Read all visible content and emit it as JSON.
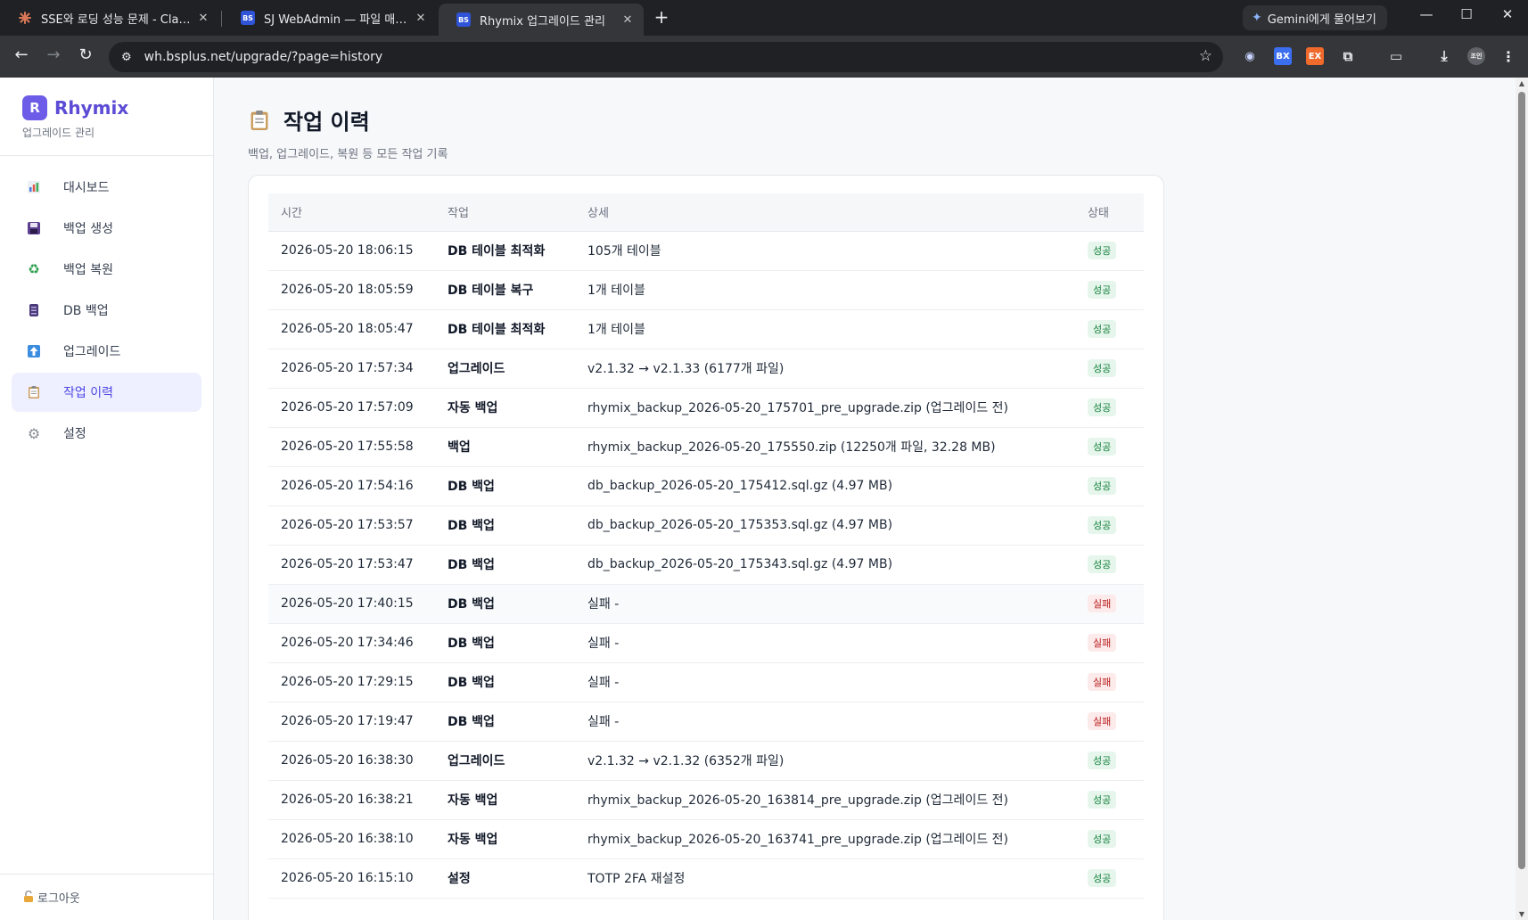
{
  "browser": {
    "tabs": [
      {
        "title": "SSE와 로딩 성능 문제 - Claude",
        "favicon": "claude-icon",
        "active": false
      },
      {
        "title": "SJ WebAdmin — 파일 매니저",
        "favicon": "bs-icon",
        "active": false
      },
      {
        "title": "Rhymix 업그레이드 관리",
        "favicon": "bs-icon",
        "active": true
      }
    ],
    "close_glyph": "✕",
    "new_tab_glyph": "+",
    "gemini_label": "Gemini에게 물어보기",
    "url": "wh.bsplus.net/upgrade/?page=history",
    "ext_labels": {
      "bx": "BX",
      "ex": "EX",
      "avatar": "조인"
    }
  },
  "sidebar": {
    "logo_letter": "R",
    "brand": "Rhymix",
    "brand_sub": "업그레이드 관리",
    "items": [
      {
        "label": "대시보드",
        "icon": "chart-icon",
        "active": false
      },
      {
        "label": "백업 생성",
        "icon": "floppy-icon",
        "active": false
      },
      {
        "label": "백업 복원",
        "icon": "recycle-icon",
        "active": false
      },
      {
        "label": "DB 백업",
        "icon": "database-icon",
        "active": false
      },
      {
        "label": "업그레이드",
        "icon": "arrow-up-icon",
        "active": false
      },
      {
        "label": "작업 이력",
        "icon": "clipboard-icon",
        "active": true
      },
      {
        "label": "설정",
        "icon": "gear-icon",
        "active": false
      }
    ],
    "logout": "로그아웃"
  },
  "main": {
    "title": "작업 이력",
    "subtitle": "백업, 업그레이드, 복원 등 모든 작업 기록",
    "table": {
      "headers": [
        "시간",
        "작업",
        "상세",
        "상태"
      ],
      "rows": [
        {
          "time": "2026-05-20 18:06:15",
          "action": "DB 테이블 최적화",
          "detail": "105개 테이블",
          "status": "성공"
        },
        {
          "time": "2026-05-20 18:05:59",
          "action": "DB 테이블 복구",
          "detail": "1개 테이블",
          "status": "성공"
        },
        {
          "time": "2026-05-20 18:05:47",
          "action": "DB 테이블 최적화",
          "detail": "1개 테이블",
          "status": "성공"
        },
        {
          "time": "2026-05-20 17:57:34",
          "action": "업그레이드",
          "detail": "v2.1.32 → v2.1.33 (6177개 파일)",
          "status": "성공"
        },
        {
          "time": "2026-05-20 17:57:09",
          "action": "자동 백업",
          "detail": "rhymix_backup_2026-05-20_175701_pre_upgrade.zip (업그레이드 전)",
          "status": "성공"
        },
        {
          "time": "2026-05-20 17:55:58",
          "action": "백업",
          "detail": "rhymix_backup_2026-05-20_175550.zip (12250개 파일, 32.28 MB)",
          "status": "성공"
        },
        {
          "time": "2026-05-20 17:54:16",
          "action": "DB 백업",
          "detail": "db_backup_2026-05-20_175412.sql.gz (4.97 MB)",
          "status": "성공"
        },
        {
          "time": "2026-05-20 17:53:57",
          "action": "DB 백업",
          "detail": "db_backup_2026-05-20_175353.sql.gz (4.97 MB)",
          "status": "성공"
        },
        {
          "time": "2026-05-20 17:53:47",
          "action": "DB 백업",
          "detail": "db_backup_2026-05-20_175343.sql.gz (4.97 MB)",
          "status": "성공"
        },
        {
          "time": "2026-05-20 17:40:15",
          "action": "DB 백업",
          "detail": "실패 -",
          "status": "실패"
        },
        {
          "time": "2026-05-20 17:34:46",
          "action": "DB 백업",
          "detail": "실패 -",
          "status": "실패"
        },
        {
          "time": "2026-05-20 17:29:15",
          "action": "DB 백업",
          "detail": "실패 -",
          "status": "실패"
        },
        {
          "time": "2026-05-20 17:19:47",
          "action": "DB 백업",
          "detail": "실패 -",
          "status": "실패"
        },
        {
          "time": "2026-05-20 16:38:30",
          "action": "업그레이드",
          "detail": "v2.1.32 → v2.1.32 (6352개 파일)",
          "status": "성공"
        },
        {
          "time": "2026-05-20 16:38:21",
          "action": "자동 백업",
          "detail": "rhymix_backup_2026-05-20_163814_pre_upgrade.zip (업그레이드 전)",
          "status": "성공"
        },
        {
          "time": "2026-05-20 16:38:10",
          "action": "자동 백업",
          "detail": "rhymix_backup_2026-05-20_163741_pre_upgrade.zip (업그레이드 전)",
          "status": "성공"
        },
        {
          "time": "2026-05-20 16:15:10",
          "action": "설정",
          "detail": "TOTP 2FA 재설정",
          "status": "성공"
        }
      ]
    }
  },
  "colors": {
    "accent": "#5b4bd5",
    "success_bg": "#e6f6ec",
    "success_fg": "#15803d",
    "fail_bg": "#fdeaea",
    "fail_fg": "#b91c1c"
  }
}
